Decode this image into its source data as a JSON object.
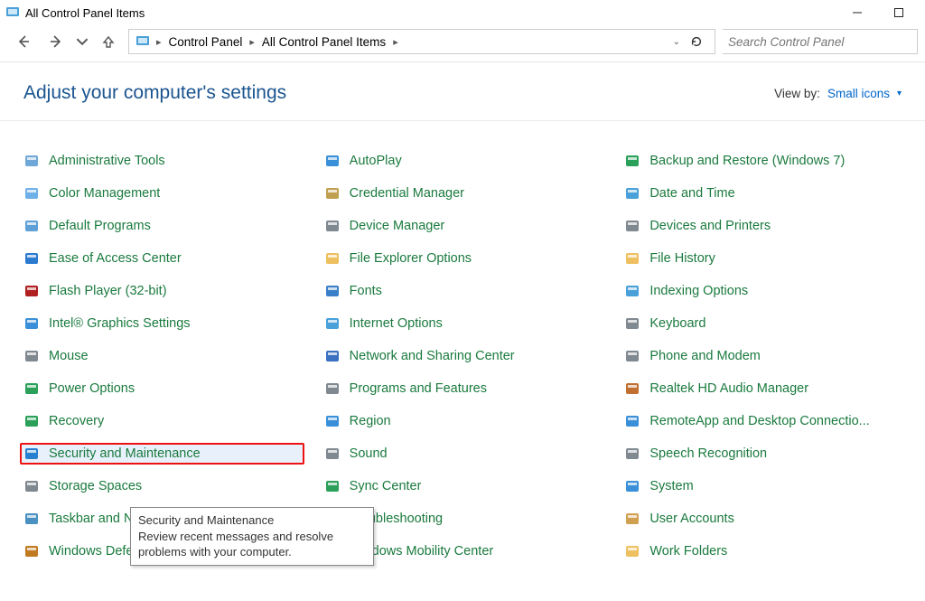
{
  "window": {
    "title": "All Control Panel Items"
  },
  "breadcrumb": {
    "root": "Control Panel",
    "current": "All Control Panel Items"
  },
  "search": {
    "placeholder": "Search Control Panel"
  },
  "header": {
    "title": "Adjust your computer's settings"
  },
  "viewby": {
    "label": "View by:",
    "value": "Small icons"
  },
  "tooltip": {
    "title": "Security and Maintenance",
    "body": "Review recent messages and resolve problems with your computer."
  },
  "items": [
    {
      "id": "admin-tools",
      "label": "Administrative Tools",
      "icon": "#6fa8d8"
    },
    {
      "id": "color-mgmt",
      "label": "Color Management",
      "icon": "#6fb0e8"
    },
    {
      "id": "default-programs",
      "label": "Default Programs",
      "icon": "#5fa0d8"
    },
    {
      "id": "ease-access",
      "label": "Ease of Access Center",
      "icon": "#2a7ad0"
    },
    {
      "id": "flash",
      "label": "Flash Player (32-bit)",
      "icon": "#b02020"
    },
    {
      "id": "intel-graphics",
      "label": "Intel® Graphics Settings",
      "icon": "#3a90d8"
    },
    {
      "id": "mouse",
      "label": "Mouse",
      "icon": "#808890"
    },
    {
      "id": "power",
      "label": "Power Options",
      "icon": "#2aa05a"
    },
    {
      "id": "recovery",
      "label": "Recovery",
      "icon": "#2aa05a"
    },
    {
      "id": "security",
      "label": "Security and Maintenance",
      "icon": "#2a80d0",
      "hl": true
    },
    {
      "id": "storage",
      "label": "Storage Spaces",
      "icon": "#808890"
    },
    {
      "id": "taskbar",
      "label": "Taskbar and Navigation",
      "icon": "#4a90c0"
    },
    {
      "id": "defender",
      "label": "Windows Defender Firewall",
      "icon": "#c07a20"
    },
    {
      "id": "autoplay",
      "label": "AutoPlay",
      "icon": "#3a90d8"
    },
    {
      "id": "credential",
      "label": "Credential Manager",
      "icon": "#c0a050"
    },
    {
      "id": "device-mgr",
      "label": "Device Manager",
      "icon": "#808890"
    },
    {
      "id": "explorer-opts",
      "label": "File Explorer Options",
      "icon": "#eec060"
    },
    {
      "id": "fonts",
      "label": "Fonts",
      "icon": "#3a80c8"
    },
    {
      "id": "internet",
      "label": "Internet Options",
      "icon": "#4aa0d8"
    },
    {
      "id": "network",
      "label": "Network and Sharing Center",
      "icon": "#3a70c0"
    },
    {
      "id": "programs",
      "label": "Programs and Features",
      "icon": "#808890"
    },
    {
      "id": "region",
      "label": "Region",
      "icon": "#3a90d8"
    },
    {
      "id": "sound",
      "label": "Sound",
      "icon": "#808890"
    },
    {
      "id": "sync",
      "label": "Sync Center",
      "icon": "#2aa05a"
    },
    {
      "id": "troubleshoot",
      "label": "Troubleshooting",
      "icon": "#4aa0d8"
    },
    {
      "id": "mobility",
      "label": "Windows Mobility Center",
      "icon": "#3a90d8"
    },
    {
      "id": "backup",
      "label": "Backup and Restore (Windows 7)",
      "icon": "#2aa05a"
    },
    {
      "id": "datetime",
      "label": "Date and Time",
      "icon": "#4aa0d8"
    },
    {
      "id": "devices-printers",
      "label": "Devices and Printers",
      "icon": "#808890"
    },
    {
      "id": "file-history",
      "label": "File History",
      "icon": "#eec060"
    },
    {
      "id": "indexing",
      "label": "Indexing Options",
      "icon": "#4aa0d8"
    },
    {
      "id": "keyboard",
      "label": "Keyboard",
      "icon": "#808890"
    },
    {
      "id": "phone-modem",
      "label": "Phone and Modem",
      "icon": "#808890"
    },
    {
      "id": "realtek",
      "label": "Realtek HD Audio Manager",
      "icon": "#c07030"
    },
    {
      "id": "remoteapp",
      "label": "RemoteApp and Desktop Connectio...",
      "icon": "#3a90d8"
    },
    {
      "id": "speech",
      "label": "Speech Recognition",
      "icon": "#808890"
    },
    {
      "id": "system",
      "label": "System",
      "icon": "#3a90d8"
    },
    {
      "id": "users",
      "label": "User Accounts",
      "icon": "#d0a050"
    },
    {
      "id": "work-folders",
      "label": "Work Folders",
      "icon": "#eec060"
    }
  ]
}
